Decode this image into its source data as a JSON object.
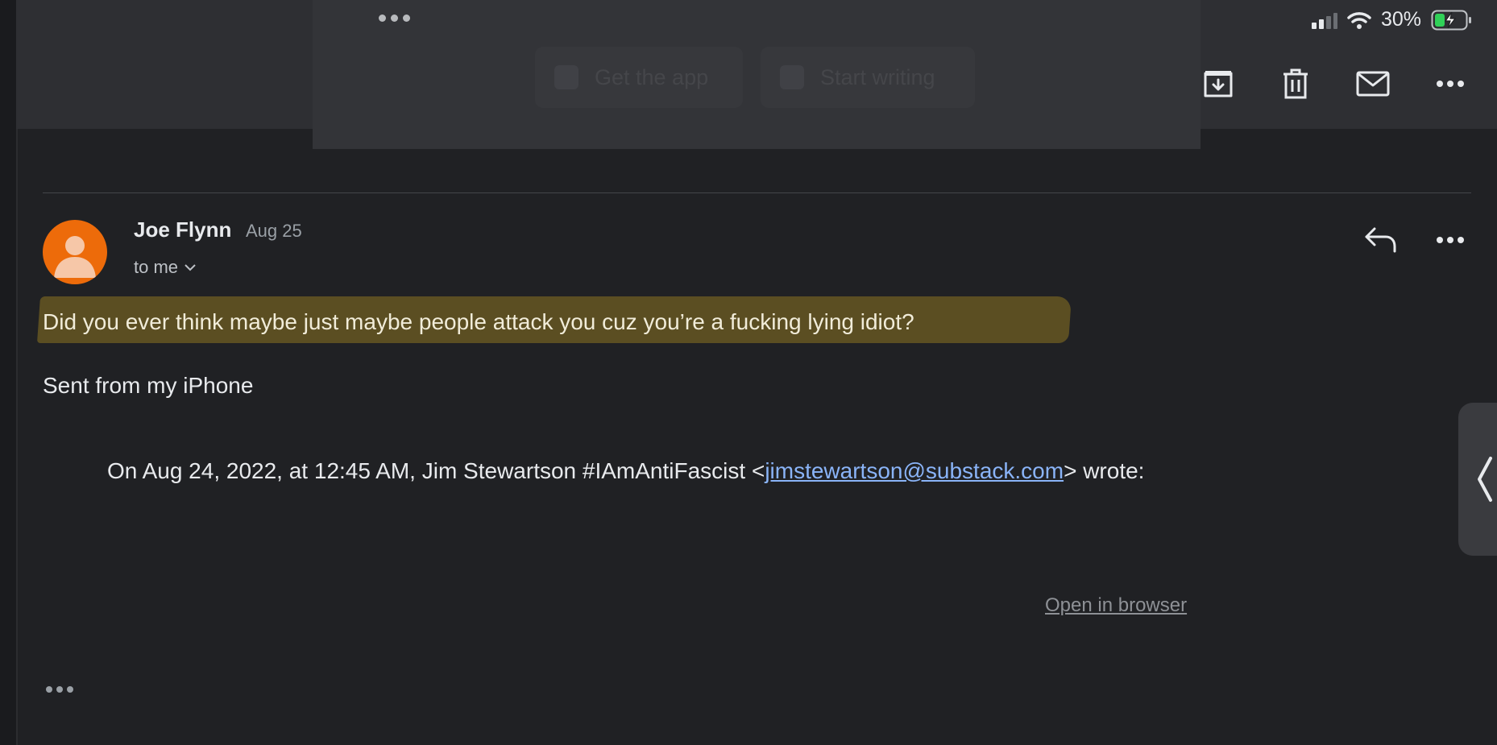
{
  "status_bar": {
    "battery": "30%"
  },
  "banner": {
    "get_app": "Get the app",
    "start_writing": "Start writing"
  },
  "toolbar": {
    "archive_icon": "archive-icon",
    "trash_icon": "trash-icon",
    "mail_icon": "mail-icon",
    "more_icon": "more-icon"
  },
  "message": {
    "sender": "Joe Flynn",
    "date": "Aug 25",
    "recipient": "to me",
    "body_line": "Did you ever think maybe just maybe people attack you cuz you’re a fucking lying idiot?",
    "signature": "Sent from my iPhone",
    "quote_prefix": "On Aug 24, 2022, at 12:45 AM, Jim Stewartson #IAmAntiFascist <",
    "quote_email": "jimstewartson@substack.com",
    "quote_suffix": "> wrote:",
    "open_in_browser": "Open in browser"
  },
  "colors": {
    "background": "#202124",
    "avatar": "#ed6b0a",
    "highlight": "#5f5123",
    "link": "#8ab4f8"
  }
}
